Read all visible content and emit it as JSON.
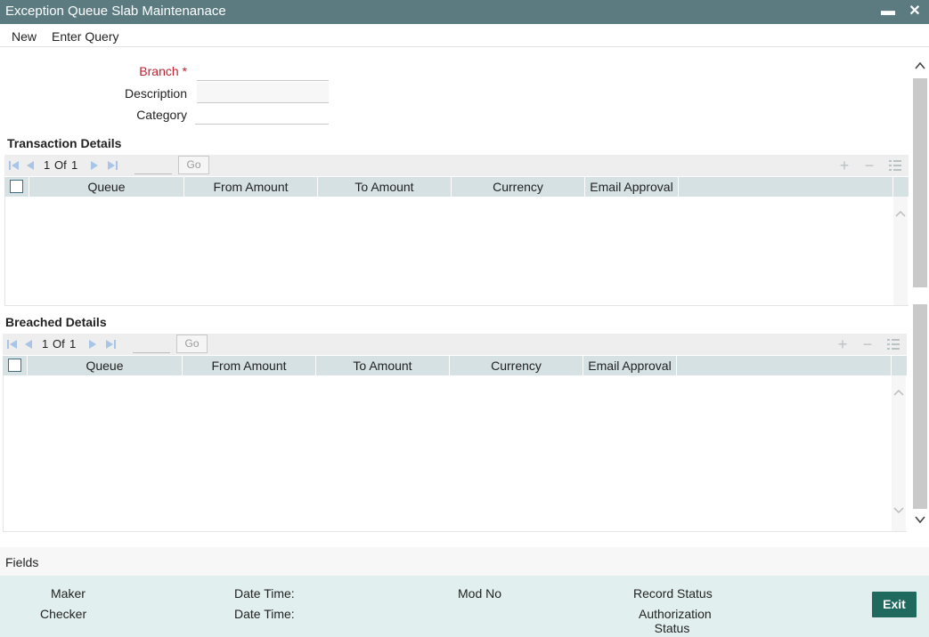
{
  "window": {
    "title": "Exception Queue Slab Maintenanace",
    "minimize_label": "▬",
    "close_label": "✕"
  },
  "menu": {
    "new_label": "New",
    "enter_query_label": "Enter Query"
  },
  "form": {
    "branch_label": "Branch",
    "required_marker": "*",
    "branch_value": "",
    "description_label": "Description",
    "description_value": "",
    "category_label": "Category",
    "category_value": ""
  },
  "transaction_details": {
    "title": "Transaction Details",
    "pager": {
      "current": "1",
      "of_label": "Of",
      "total": "1",
      "go_label": "Go"
    },
    "columns": [
      "Queue",
      "From Amount",
      "To Amount",
      "Currency",
      "Email Approval"
    ],
    "rows": []
  },
  "breached_details": {
    "title": "Breached Details",
    "pager": {
      "current": "1",
      "of_label": "Of",
      "total": "1",
      "go_label": "Go"
    },
    "columns": [
      "Queue",
      "From Amount",
      "To Amount",
      "Currency",
      "Email Approval"
    ],
    "rows": []
  },
  "fields_label": "Fields",
  "footer": {
    "maker_label": "Maker",
    "checker_label": "Checker",
    "date_time_label_1": "Date Time:",
    "date_time_label_2": "Date Time:",
    "mod_no_label": "Mod No",
    "record_status_label": "Record Status",
    "authorization_status_line1": "Authorization",
    "authorization_status_line2": "Status",
    "exit_label": "Exit"
  },
  "colors": {
    "title_bar": "#5b7b80",
    "grid_header": "#d6e1e3",
    "footer_bg": "#e2efef",
    "exit_button": "#20695f",
    "required_label": "#c0212f"
  }
}
